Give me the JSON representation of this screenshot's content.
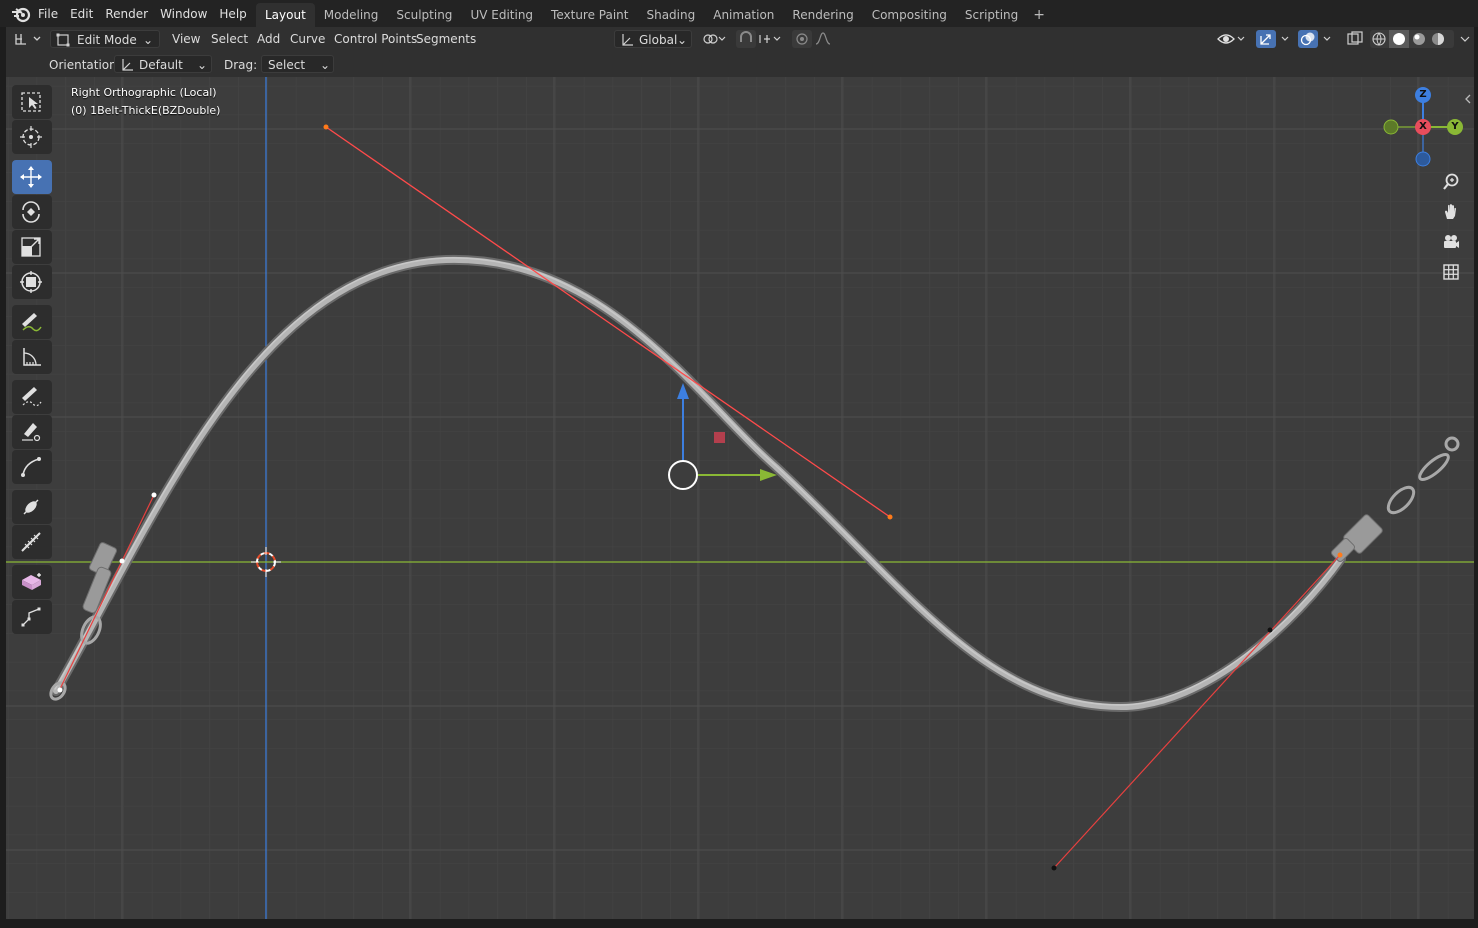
{
  "menus": [
    "File",
    "Edit",
    "Render",
    "Window",
    "Help"
  ],
  "workspaces": [
    "Layout",
    "Modeling",
    "Sculpting",
    "UV Editing",
    "Texture Paint",
    "Shading",
    "Animation",
    "Rendering",
    "Compositing",
    "Scripting"
  ],
  "active_workspace": "Layout",
  "add_workspace": "+",
  "header": {
    "mode": "Edit Mode",
    "menu": [
      "View",
      "Select",
      "Add",
      "Curve",
      "Control Points",
      "Segments"
    ],
    "transform_orientation": "Global"
  },
  "tool_options": {
    "orientation_label": "Orientation:",
    "orientation_value": "Default",
    "drag_label": "Drag:",
    "drag_value": "Select Box"
  },
  "viewport": {
    "view_name": "Right Orthographic (Local)",
    "object_name": "(0) 1Belt-ThickE(BZDouble)",
    "axis_z": "Z",
    "axis_x": "X",
    "axis_y": "Y"
  },
  "colors": {
    "active_tool": "#4772b3",
    "axis_x": "#e84d5c",
    "axis_y": "#8ab835",
    "axis_z": "#3d7fe0",
    "handle_line": "#e8403f",
    "curve": "#a8a8a8"
  },
  "tools": [
    "select-box",
    "cursor",
    "move",
    "rotate",
    "scale",
    "transform",
    "annotate",
    "measure",
    "draw",
    "pen",
    "curve-tilt",
    "randomize",
    "extrude",
    "radius",
    "vertex"
  ],
  "nav_buttons": [
    "zoom-icon",
    "hand-icon",
    "camera-icon",
    "grid-icon"
  ]
}
